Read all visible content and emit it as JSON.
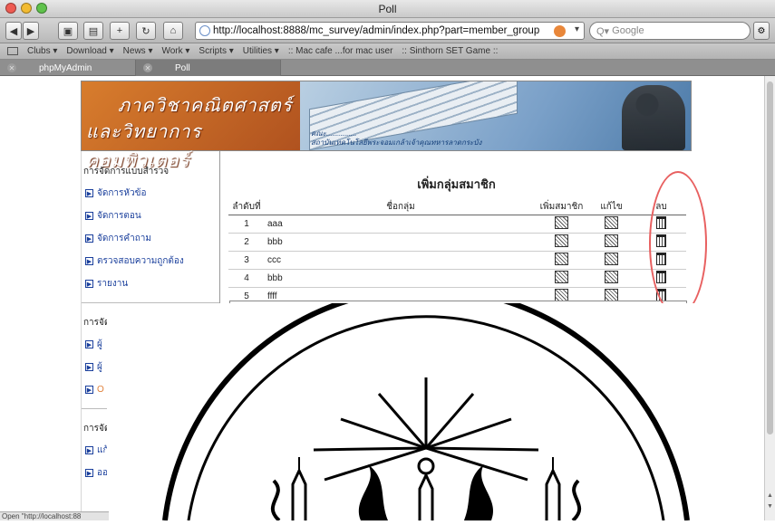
{
  "window": {
    "title": "Poll"
  },
  "toolbar": {
    "url": "http://localhost:8888/mc_survey/admin/index.php?part=member_group",
    "search_placeholder": "Google"
  },
  "bookmarks": [
    "Clubs ▾",
    "Download ▾",
    "News ▾",
    "Work ▾",
    "Scripts ▾",
    "Utilities ▾",
    ":: Mac cafe ...for mac user",
    ":: Sinthorn SET Game ::"
  ],
  "tabs": [
    {
      "label": "phpMyAdmin"
    },
    {
      "label": "Poll"
    }
  ],
  "banner": {
    "line1": "ภาควิชาคณิตศาสตร์",
    "line2": "และวิทยาการคอมพิวเตอร์",
    "sub1": "คณะ...............",
    "sub2": "สถาบันเทคโนโลยีพระจอมเกล้าเจ้าคุณทหารลาดกระบัง"
  },
  "sidebar": {
    "heading1": "การจัดการแบบสำรวจ",
    "items1": [
      "จัดการหัวข้อ",
      "จัดการตอน",
      "จัดการคำถาม",
      "ตรวจสอบความถูกต้อง",
      "รายงาน"
    ],
    "heading2": "การจัด",
    "items2": [
      "ผู้",
      "ผู้",
      "O"
    ],
    "heading3": "การจัด",
    "items3": [
      "แก้",
      "ออ"
    ]
  },
  "main": {
    "title": "เพิ่มกลุ่มสมาชิก",
    "columns": [
      "ลำดับที่",
      "ชื่อกลุ่ม",
      "เพิ่มสมาชิก",
      "แก้ไข",
      "ลบ"
    ],
    "rows": [
      {
        "no": "1",
        "name": "aaa"
      },
      {
        "no": "2",
        "name": "bbb"
      },
      {
        "no": "3",
        "name": "ccc"
      },
      {
        "no": "4",
        "name": "bbb"
      },
      {
        "no": "5",
        "name": "ffff"
      }
    ]
  },
  "status": {
    "text": "Open \"http://localhost:88"
  },
  "colors": {
    "banner_orange": "#d87d2d",
    "link_blue": "#1a3f9c",
    "annotation_red": "#e86060"
  }
}
